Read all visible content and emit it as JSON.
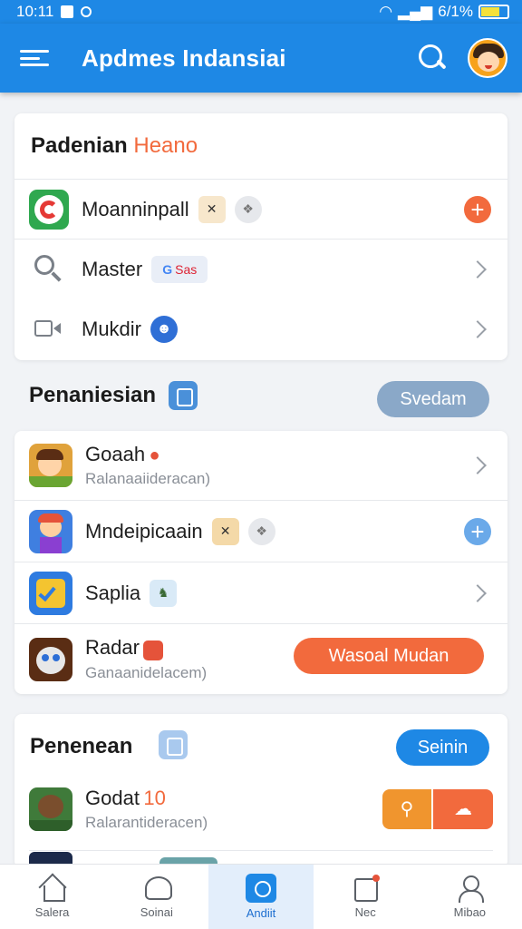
{
  "status": {
    "time": "10:11",
    "battery": "6/1%"
  },
  "appbar": {
    "title": "Apdmes Indansiai"
  },
  "card1": {
    "title_main": "Padenian",
    "title_accent": "Heano",
    "rows": [
      {
        "label": "Moanninpall"
      },
      {
        "label": "Master",
        "badge": "Sas"
      },
      {
        "label": "Mukdir"
      }
    ]
  },
  "section2": {
    "title": "Penaniesian",
    "button": "Svedam"
  },
  "card2": {
    "rows": [
      {
        "label": "Goaah",
        "sub": "Ralanaaiideracan)"
      },
      {
        "label": "Mndeipicaain"
      },
      {
        "label": "Saplia"
      },
      {
        "label": "Radar",
        "sub": "Ganaanidelacem)",
        "button": "Wasoal Mudan"
      }
    ]
  },
  "card3": {
    "title": "Penenean",
    "button": "Seinin",
    "rows": [
      {
        "label": "Godat",
        "label_accent": "10",
        "sub": "Ralarantideracen)"
      }
    ]
  },
  "bottomnav": {
    "items": [
      {
        "label": "Salera"
      },
      {
        "label": "Soinai"
      },
      {
        "label": "Andiit"
      },
      {
        "label": "Nec"
      },
      {
        "label": "Mibao"
      }
    ]
  },
  "colors": {
    "primary": "#1e88e5",
    "accent": "#f26a3d",
    "slate_pill": "#8aa8c8"
  }
}
